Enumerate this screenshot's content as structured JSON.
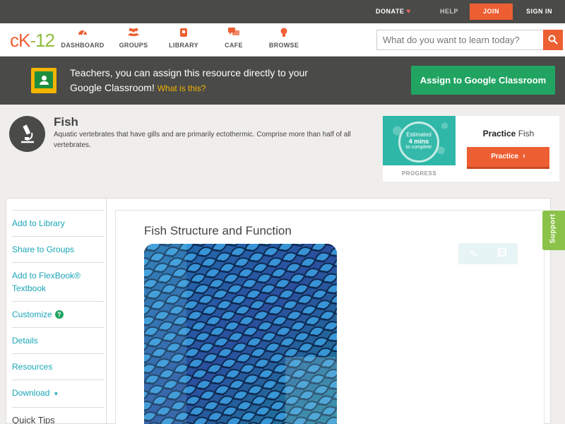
{
  "topbar": {
    "donate": "DONATE",
    "help": "HELP",
    "join": "JOIN",
    "signin": "SIGN IN"
  },
  "logo": {
    "text": "cK-12"
  },
  "nav": {
    "items": [
      {
        "label": "DASHBOARD",
        "icon": "dashboard-icon"
      },
      {
        "label": "GROUPS",
        "icon": "groups-icon"
      },
      {
        "label": "LIBRARY",
        "icon": "library-icon"
      },
      {
        "label": "CAFE",
        "icon": "cafe-icon"
      },
      {
        "label": "BROWSE",
        "icon": "browse-icon"
      }
    ],
    "search_placeholder": "What do you want to learn today?"
  },
  "banner": {
    "text": "Teachers, you can assign this resource directly to your Google Classroom!",
    "link": "What is this?",
    "assign_button": "Assign to Google Classroom"
  },
  "concept": {
    "title": "Fish",
    "description": "Aquatic vertebrates that have gills and are primarily ectothermic. Comprise more than half of all vertebrates."
  },
  "practice": {
    "estimated": "Estimated",
    "mins": "4 mins",
    "to_complete": "to complete",
    "progress_label": "PROGRESS",
    "heading_bold": "Practice",
    "heading_rest": "Fish",
    "button": "Practice"
  },
  "sidebar": {
    "items": [
      {
        "label": "Add to Library"
      },
      {
        "label": "Share to Groups"
      },
      {
        "label": "Add to FlexBook® Textbook"
      },
      {
        "label": "Customize"
      },
      {
        "label": "Details"
      },
      {
        "label": "Resources"
      },
      {
        "label": "Download"
      }
    ],
    "quick_tips": "Quick Tips"
  },
  "lesson": {
    "title": "Fish Structure and Function"
  },
  "support": "Support",
  "colors": {
    "accent_orange": "#ed5f33",
    "teal_link": "#1aa6b7",
    "google_green": "#21a462",
    "dark_bar": "#4a4a48"
  }
}
